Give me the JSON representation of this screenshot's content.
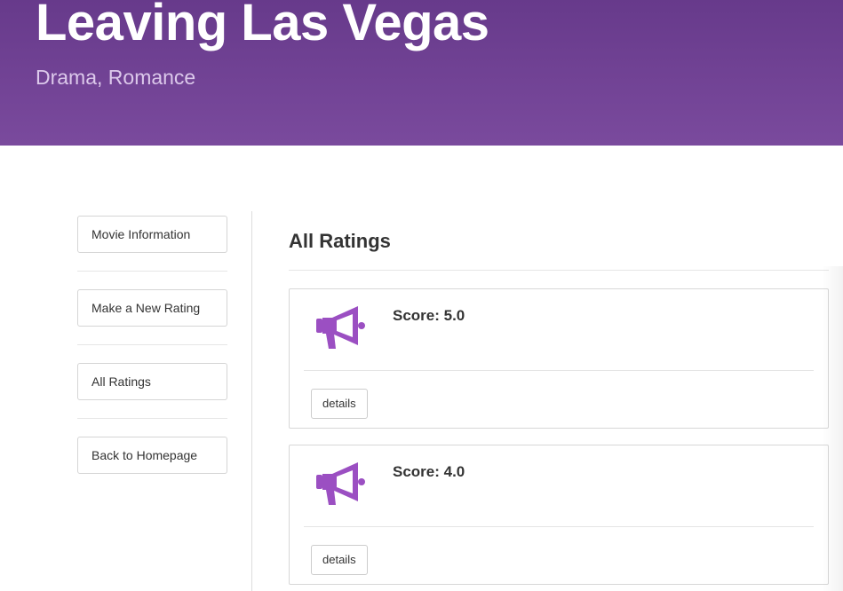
{
  "header": {
    "title": "Leaving Las Vegas",
    "subtitle": "Drama, Romance"
  },
  "sidebar": {
    "items": [
      {
        "label": "Movie Information"
      },
      {
        "label": "Make a New Rating"
      },
      {
        "label": "All Ratings"
      },
      {
        "label": "Back to Homepage"
      }
    ]
  },
  "main": {
    "title": "All Ratings",
    "ratings": [
      {
        "score": "Score: 5.0",
        "icon": "megaphone-icon",
        "details_label": "details"
      },
      {
        "score": "Score: 4.0",
        "icon": "megaphone-icon",
        "details_label": "details"
      }
    ]
  },
  "colors": {
    "header_bg_top": "#673a8b",
    "header_bg_bottom": "#7a4a9d",
    "subtitle": "#dcc9eb",
    "icon_accent": "#9b4fc2"
  }
}
